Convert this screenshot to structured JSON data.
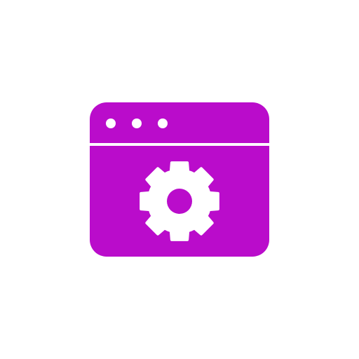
{
  "icon": {
    "name": "browser-window-settings-icon",
    "color": "#BA0CCB",
    "foreground": "#FFFFFF",
    "title_bar_dots": 3,
    "center_glyph": "gear-icon"
  }
}
